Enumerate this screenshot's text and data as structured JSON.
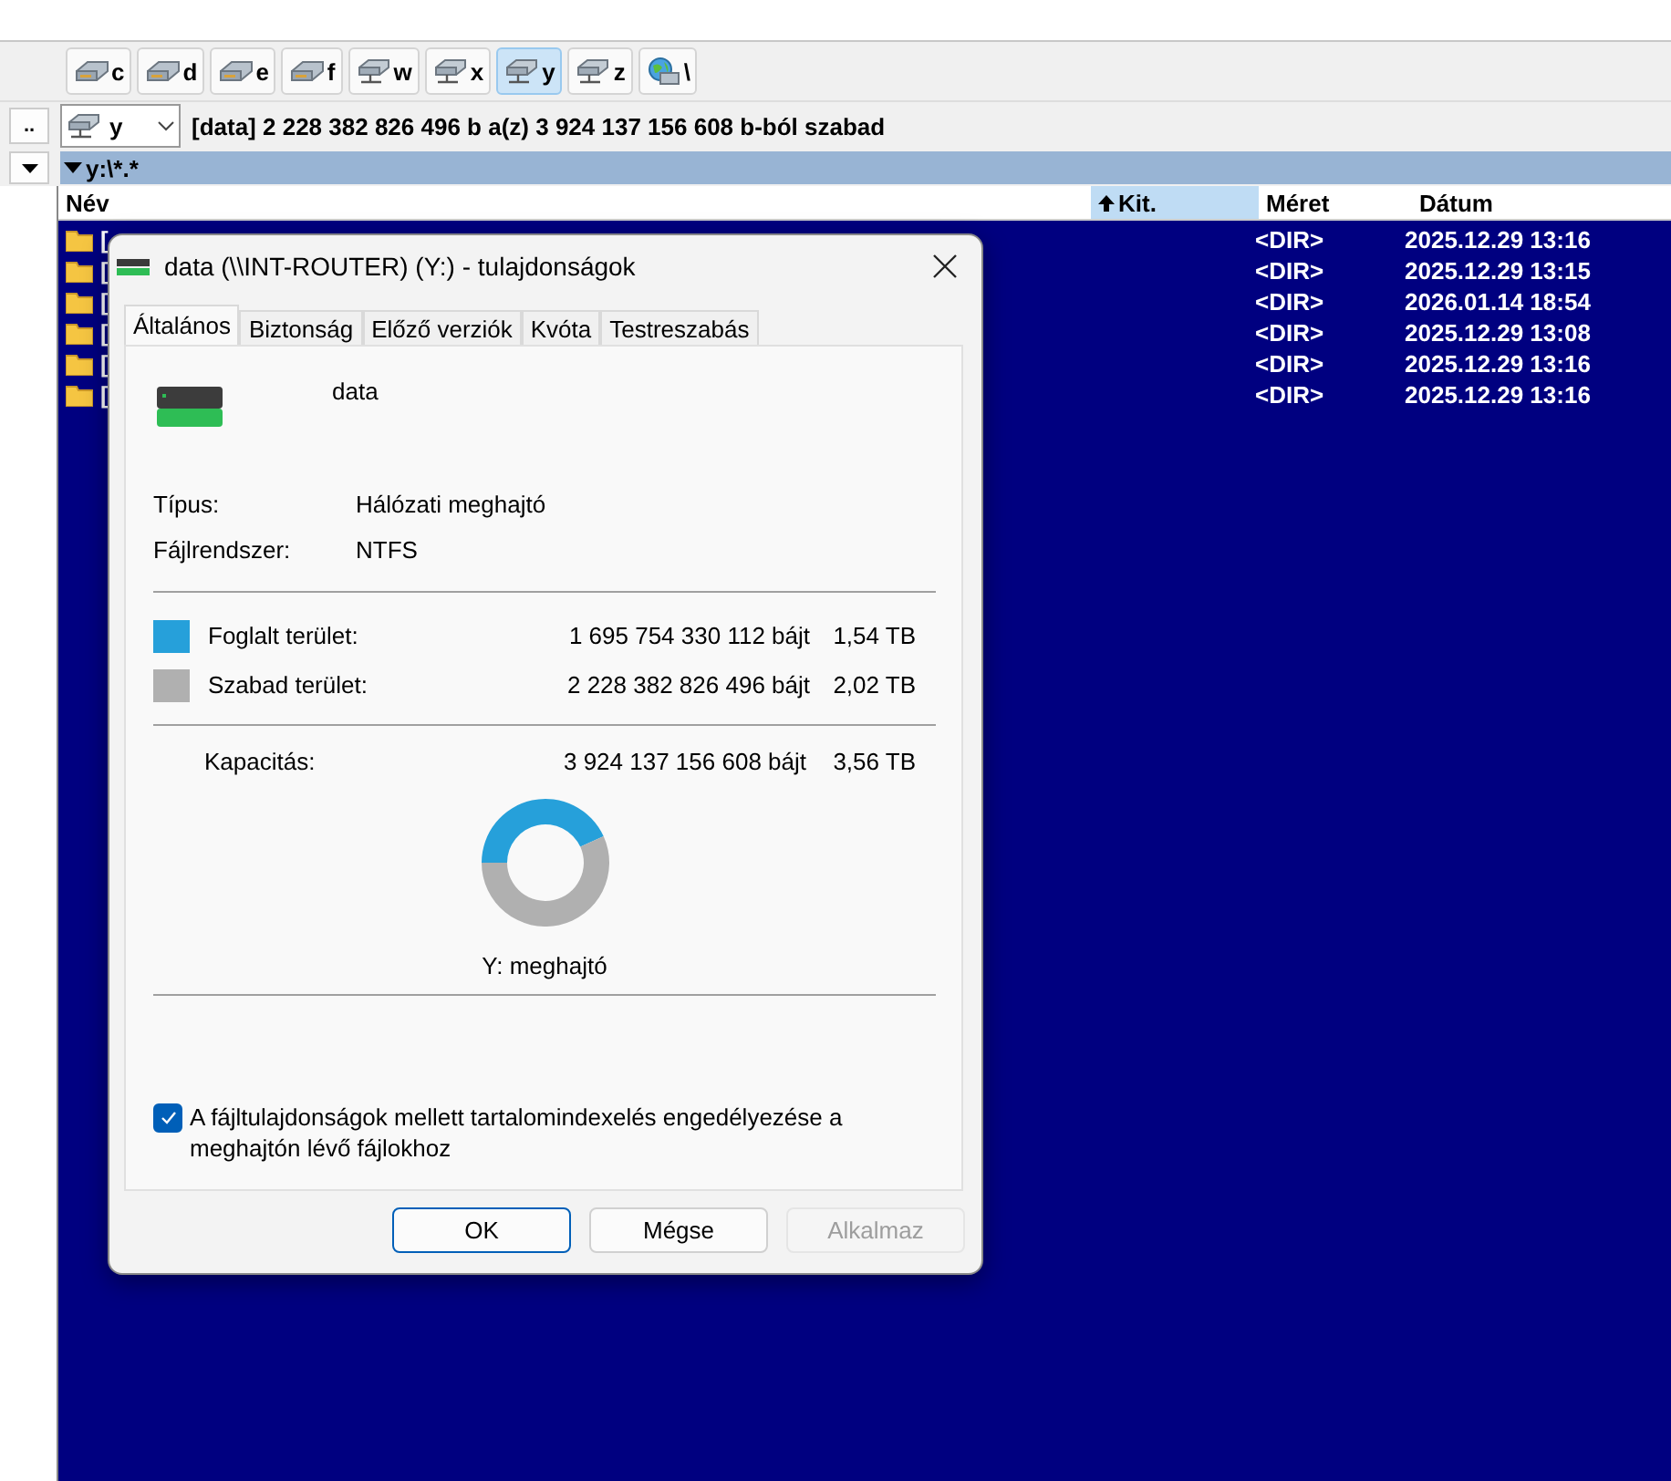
{
  "drive_bar": [
    {
      "letter": "c",
      "kind": "local",
      "selected": false
    },
    {
      "letter": "d",
      "kind": "local",
      "selected": false
    },
    {
      "letter": "e",
      "kind": "local",
      "selected": false
    },
    {
      "letter": "f",
      "kind": "local",
      "selected": false
    },
    {
      "letter": "w",
      "kind": "network",
      "selected": false
    },
    {
      "letter": "x",
      "kind": "network",
      "selected": false
    },
    {
      "letter": "y",
      "kind": "network",
      "selected": true
    },
    {
      "letter": "z",
      "kind": "network",
      "selected": false
    },
    {
      "letter": "\\",
      "kind": "globe",
      "selected": false
    }
  ],
  "up_button": "..",
  "drive_combo": {
    "value": "y",
    "kind": "network"
  },
  "free_space_info": "[data]  2 228 382 826 496 b a(z) 3 924 137 156 608 b-ból szabad",
  "path": "y:\\*.*",
  "file_list": {
    "columns": [
      {
        "label": "Név",
        "sorted": false
      },
      {
        "label": "Kit.",
        "sorted": true
      },
      {
        "label": "Méret",
        "sorted": false
      },
      {
        "label": "Dátum",
        "sorted": false
      }
    ],
    "rows": [
      {
        "name": "[",
        "size": "<DIR>",
        "date": "2025.12.29 13:16"
      },
      {
        "name": "[",
        "size": "<DIR>",
        "date": "2025.12.29 13:15"
      },
      {
        "name": "[",
        "size": "<DIR>",
        "date": "2026.01.14 18:54"
      },
      {
        "name": "[",
        "size": "<DIR>",
        "date": "2025.12.29 13:08"
      },
      {
        "name": "[",
        "size": "<DIR>",
        "date": "2025.12.29 13:16"
      },
      {
        "name": "[",
        "size": "<DIR>",
        "date": "2025.12.29 13:16"
      }
    ]
  },
  "dialog": {
    "title": "data (\\\\INT-ROUTER) (Y:) - tulajdonságok",
    "tabs": [
      {
        "label": "Általános",
        "selected": true
      },
      {
        "label": "Biztonság",
        "selected": false
      },
      {
        "label": "Előző verziók",
        "selected": false
      },
      {
        "label": "Kvóta",
        "selected": false
      },
      {
        "label": "Testreszabás",
        "selected": false
      }
    ],
    "drive_name": "data",
    "properties": [
      {
        "label": "Típus:",
        "value": "Hálózati meghajtó"
      },
      {
        "label": "Fájlrendszer:",
        "value": "NTFS"
      }
    ],
    "space": [
      {
        "label": "Foglalt terület:",
        "bytes": "1 695 754 330 112 bájt",
        "size": "1,54 TB",
        "color": "#26a0da"
      },
      {
        "label": "Szabad terület:",
        "bytes": "2 228 382 826 496 bájt",
        "size": "2,02 TB",
        "color": "#b0b0b0"
      }
    ],
    "capacity": {
      "label": "Kapacitás:",
      "bytes": "3 924 137 156 608 bájt",
      "size": "3,56 TB"
    },
    "chart_data": {
      "type": "donut",
      "values": [
        43.21,
        56.79
      ]
    },
    "drive_label": "Y: meghajtó",
    "indexing": {
      "label": "A fájltulajdonságok mellett tartalomindexelés engedélyezése a meghajtón lévő fájlokhoz",
      "checked": true
    },
    "buttons": [
      {
        "label": "OK",
        "kind": "default",
        "disabled": false
      },
      {
        "label": "Mégse",
        "kind": "normal",
        "disabled": false
      },
      {
        "label": "Alkalmaz",
        "kind": "normal",
        "disabled": true
      }
    ]
  }
}
